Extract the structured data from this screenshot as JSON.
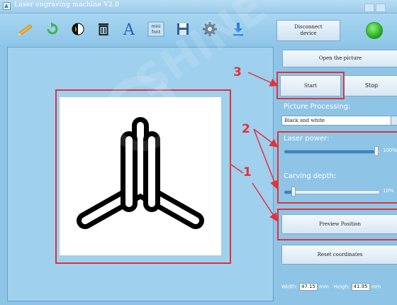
{
  "window": {
    "title": "Laser engraving machine V2.0"
  },
  "toolbar": {
    "icons": [
      "pencil-icon",
      "refresh-icon",
      "contrast-icon",
      "delete-icon",
      "text-icon",
      "mini-font-icon",
      "save-icon",
      "settings-icon",
      "download-icon"
    ],
    "mini_font_top": "mini",
    "mini_font_bottom": "font",
    "text_glyph": "A",
    "disconnect_line1": "Disconnect",
    "disconnect_line2": "device",
    "status_color": "#1fa31a"
  },
  "right_panel": {
    "open_picture": "Open the picture",
    "start": "Start",
    "stop": "Stop",
    "picture_processing_label": "Picture Processing:",
    "picture_processing_value": "Black and white",
    "laser_power_label": "Laser power:",
    "laser_power_value": "100%",
    "laser_power_fraction": 1.0,
    "carving_depth_label": "Carving depth:",
    "carving_depth_value": "10%",
    "carving_depth_fraction": 0.1,
    "preview_position": "Preview Position",
    "reset_coordinates": "Reset coordinates",
    "width_label": "Width:",
    "width_value": "47.15",
    "width_unit": "mm",
    "height_label": "Heigh:",
    "height_value": "41.95",
    "height_unit": "mm"
  },
  "annotations": {
    "label_1": "1",
    "label_2": "2",
    "label_3": "3",
    "color": "#e0333b"
  },
  "watermark": {
    "text": "SHINE"
  }
}
